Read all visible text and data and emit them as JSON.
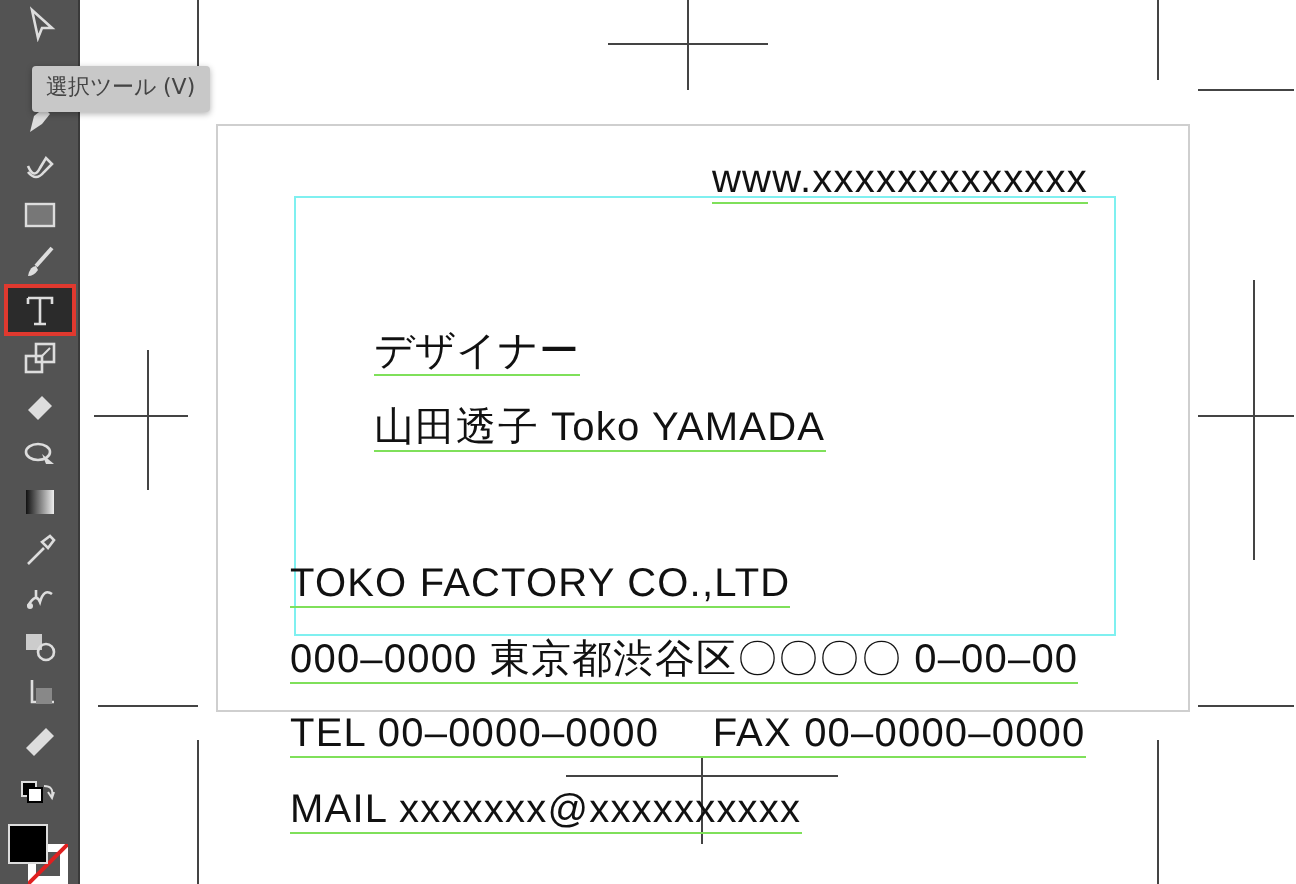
{
  "toolbar": {
    "tools": [
      {
        "kind": "select",
        "selected": false
      },
      {
        "kind": "pen",
        "selected": false
      },
      {
        "kind": "curvature",
        "selected": false
      },
      {
        "kind": "rect",
        "selected": false
      },
      {
        "kind": "brush",
        "selected": false
      },
      {
        "kind": "type",
        "selected": true
      },
      {
        "kind": "scale",
        "selected": false
      },
      {
        "kind": "eraser",
        "selected": false
      },
      {
        "kind": "shapebuilder",
        "selected": false
      },
      {
        "kind": "gradient",
        "selected": false
      },
      {
        "kind": "eyedropper",
        "selected": false
      },
      {
        "kind": "puppet",
        "selected": false
      },
      {
        "kind": "blend",
        "selected": false
      },
      {
        "kind": "artboard",
        "selected": false
      },
      {
        "kind": "ruler",
        "selected": false
      }
    ]
  },
  "tooltip": {
    "text": "選択ツール (V)"
  },
  "card": {
    "lines": [
      {
        "text": "www.xxxxxxxxxxxxx"
      },
      {
        "text": "デザイナー"
      },
      {
        "text": "山田透子 Toko YAMADA"
      },
      {
        "text": "TOKO FACTORY CO.,LTD"
      },
      {
        "text": "000–0000 東京都渋谷区〇〇〇〇 0–00–00"
      },
      {
        "text": "TEL 00–0000–0000　 FAX 00–0000–0000"
      },
      {
        "text": "MAIL xxxxxxx@xxxxxxxxxx"
      }
    ]
  }
}
